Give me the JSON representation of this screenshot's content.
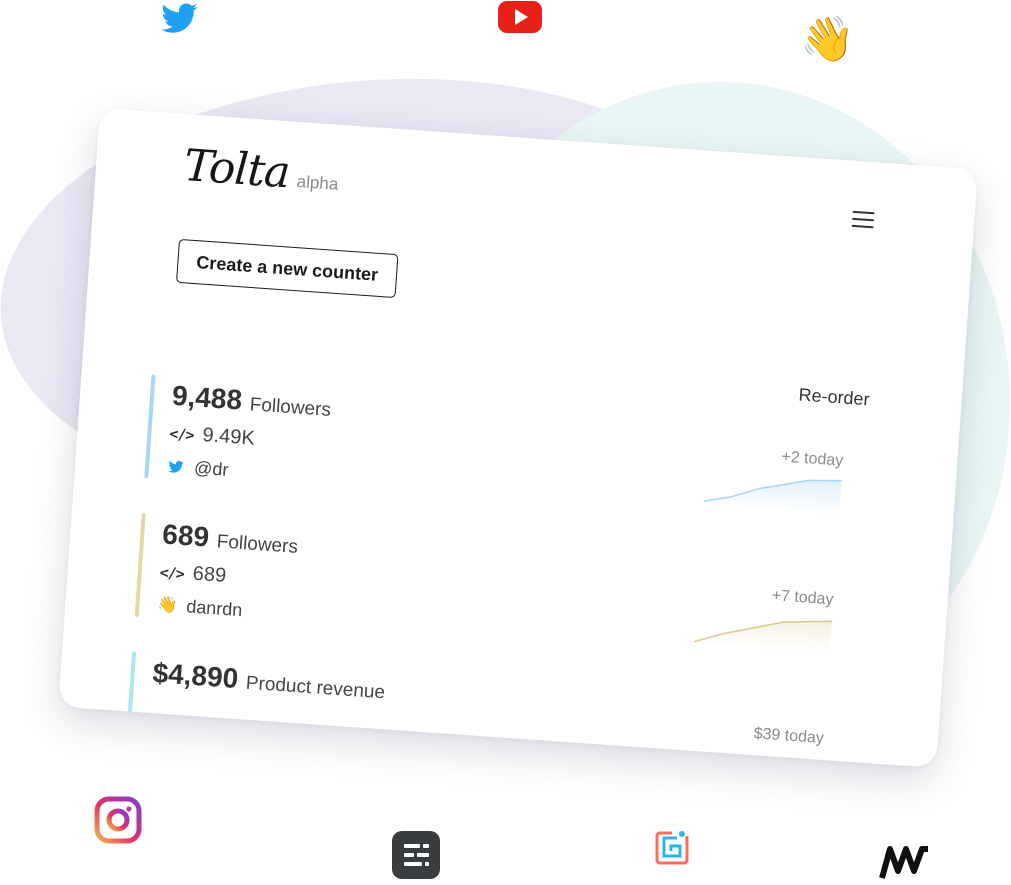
{
  "app": {
    "logo": "Tolta",
    "tag": "alpha"
  },
  "actions": {
    "create_label": "Create a new counter",
    "reorder_label": "Re-order"
  },
  "counters": [
    {
      "value": "9,488",
      "label": "Followers",
      "embed_value": "9.49K",
      "handle": "@dr",
      "today": "+2 today",
      "source_icon": "twitter-icon",
      "accent": "#a9d6f5"
    },
    {
      "value": "689",
      "label": "Followers",
      "embed_value": "689",
      "handle": "danrdn",
      "today": "+7 today",
      "source_icon": "clap-icon",
      "accent": "#e3d7a8"
    },
    {
      "value": "$4,890",
      "label": "Product revenue",
      "embed_value": "",
      "handle": "",
      "today": "$39 today",
      "source_icon": "",
      "accent": "#a7e8ee"
    }
  ],
  "floating_icons": [
    "twitter-icon",
    "youtube-icon",
    "clap-icon",
    "instagram-icon",
    "tally-form-icon",
    "gumroad-style-icon",
    "chartmogul-icon"
  ],
  "colors": {
    "twitter": "#1da1f2",
    "youtube": "#ff0000",
    "blob_purple": "#e9e8f4",
    "blob_teal": "#e8f7f5"
  }
}
